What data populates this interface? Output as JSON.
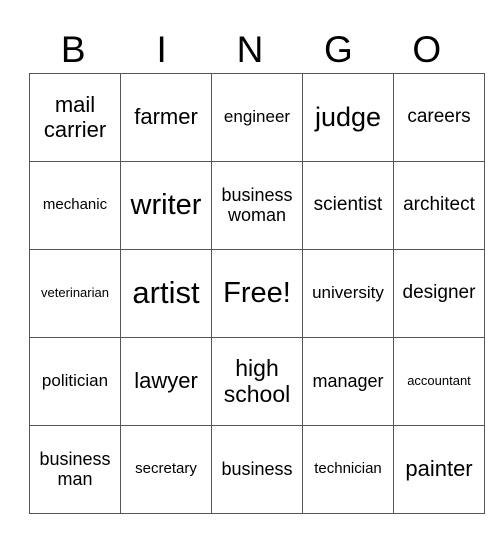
{
  "header": [
    "B",
    "I",
    "N",
    "G",
    "O"
  ],
  "cells": [
    [
      "mail carrier",
      "farmer",
      "engineer",
      "judge",
      "careers"
    ],
    [
      "mechanic",
      "writer",
      "business woman",
      "scientist",
      "architect"
    ],
    [
      "veterinarian",
      "artist",
      "Free!",
      "university",
      "designer"
    ],
    [
      "politician",
      "lawyer",
      "high school",
      "manager",
      "accountant"
    ],
    [
      "business man",
      "secretary",
      "business",
      "technician",
      "painter"
    ]
  ]
}
